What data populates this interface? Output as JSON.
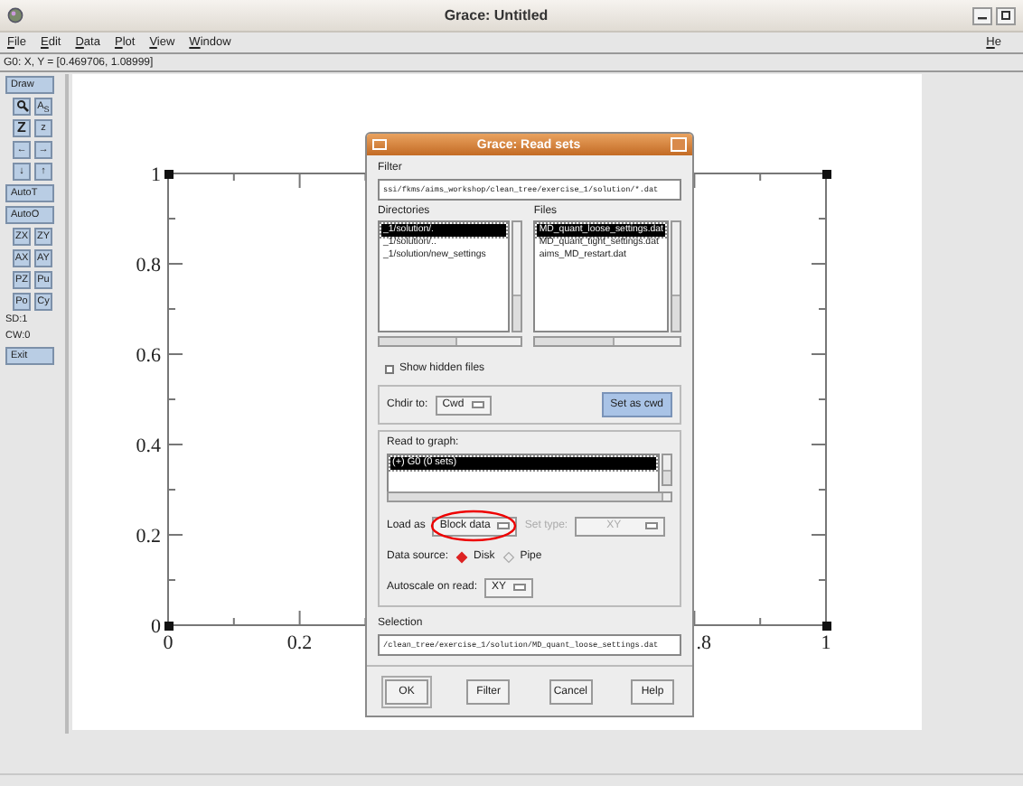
{
  "window": {
    "title": "Grace: Untitled"
  },
  "menu": [
    {
      "label": "File"
    },
    {
      "label": "Edit"
    },
    {
      "label": "Data"
    },
    {
      "label": "Plot"
    },
    {
      "label": "View"
    },
    {
      "label": "Window"
    }
  ],
  "menu_right": "He",
  "coordinates": "G0: X, Y = [0.469706, 1.08999]",
  "toolbar": [
    {
      "kind": "wide",
      "label": "Draw"
    },
    {
      "kind": "zoom_row",
      "label": "A$_{S}$"
    },
    {
      "kind": "pair",
      "labels": [
        "Z",
        "z"
      ]
    },
    {
      "kind": "pair",
      "labels": [
        "←",
        "→"
      ]
    },
    {
      "kind": "pair",
      "labels": [
        "↓",
        "↑"
      ]
    },
    {
      "kind": "wide",
      "label": "AutoT"
    },
    {
      "kind": "wide",
      "label": "AutoO"
    },
    {
      "kind": "pair",
      "labels": [
        "ZX",
        "ZY"
      ]
    },
    {
      "kind": "pair",
      "labels": [
        "AX",
        "AY"
      ]
    },
    {
      "kind": "pair",
      "labels": [
        "PZ",
        "Pu"
      ]
    },
    {
      "kind": "pair",
      "labels": [
        "Po",
        "Cy"
      ]
    },
    {
      "kind": "text",
      "label": "SD:1"
    },
    {
      "kind": "text",
      "label": "CW:0"
    },
    {
      "kind": "wide",
      "label": "Exit"
    }
  ],
  "plot": {
    "y_labels": [
      "1",
      "0.8",
      "0.6",
      "0.4",
      "0.2",
      "0"
    ],
    "x_labels": [
      "0",
      "0.2",
      ".8",
      "1"
    ]
  },
  "dialog": {
    "title": "Grace: Read sets",
    "filter_label": "Filter",
    "filter": "ssi/fkms/aims_workshop/clean_tree/exercise_1/solution/*.dat",
    "directories_label": "Directories",
    "directories": [
      {
        "name": "_1/solution/.",
        "selected": true
      },
      {
        "name": "_1/solution/..",
        "selected": false
      },
      {
        "name": "_1/solution/new_settings",
        "selected": false
      }
    ],
    "files_label": "Files",
    "files": [
      {
        "name": "MD_quant_loose_settings.dat",
        "selected": true
      },
      {
        "name": "MD_quant_tight_settings.dat",
        "selected": false
      },
      {
        "name": "aims_MD_restart.dat",
        "selected": false
      }
    ],
    "show_hidden": {
      "label": "Show hidden files",
      "checked": false
    },
    "chdir": {
      "label": "Chdir to:",
      "value": "Cwd",
      "button": "Set as cwd"
    },
    "read_to_graph": {
      "label": "Read to graph:",
      "items": [
        {
          "name": "(+) G0 (0 sets)",
          "selected": true
        }
      ]
    },
    "load_as": {
      "label": "Load as",
      "value": "Block data",
      "highlighted": true
    },
    "set_type": {
      "label": "Set type:",
      "value": "XY",
      "disabled": true
    },
    "data_source": {
      "label": "Data source:",
      "options": [
        {
          "label": "Disk",
          "selected": true
        },
        {
          "label": "Pipe",
          "selected": false
        }
      ]
    },
    "autoscale": {
      "label": "Autoscale on read:",
      "value": "XY"
    },
    "selection_label": "Selection",
    "selection": "/clean_tree/exercise_1/solution/MD_quant_loose_settings.dat",
    "buttons": [
      "OK",
      "Filter",
      "Cancel",
      "Help"
    ]
  }
}
